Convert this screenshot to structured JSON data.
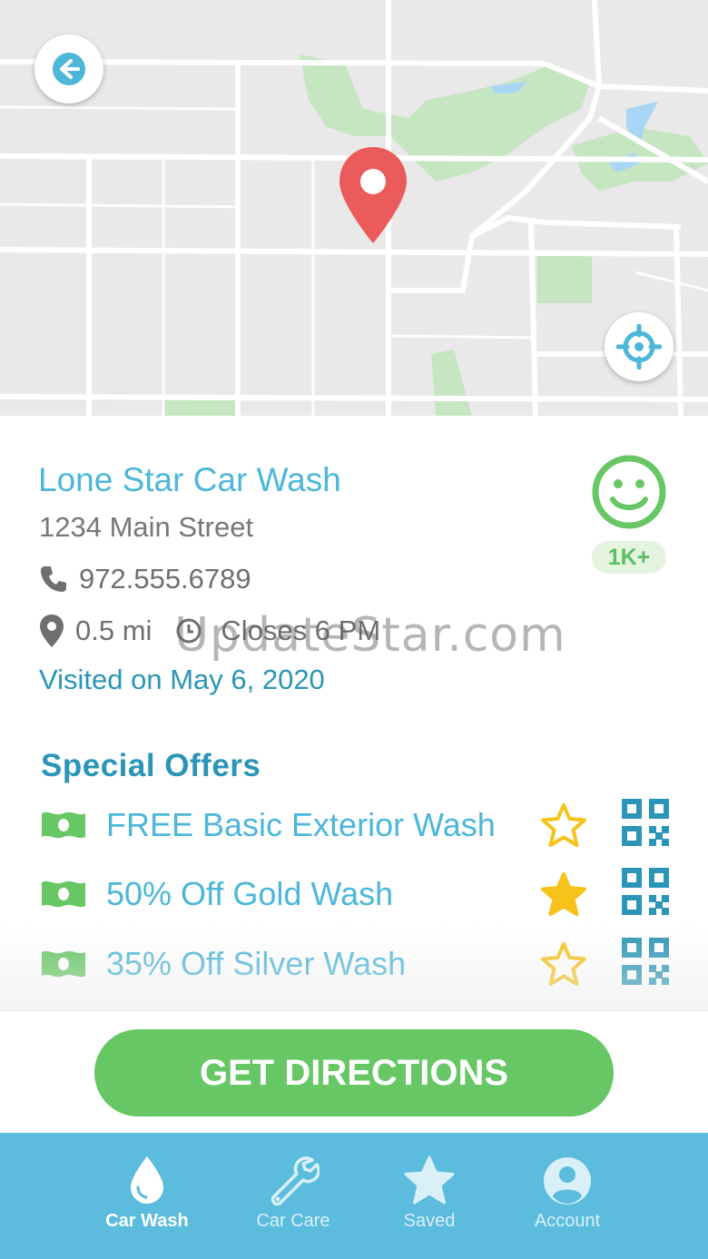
{
  "store": {
    "name": "Lone Star Car Wash",
    "address": "1234 Main Street",
    "phone": "972.555.6789",
    "distance": "0.5 mi",
    "hours": "Closes 6 PM",
    "visited": "Visited on May 6, 2020",
    "rating_badge": "1K+"
  },
  "offers": {
    "title": "Special Offers",
    "items": [
      {
        "label": "FREE Basic Exterior Wash",
        "favorited": false
      },
      {
        "label": "50% Off Gold Wash",
        "favorited": true
      },
      {
        "label": "35% Off Silver Wash",
        "favorited": false
      }
    ]
  },
  "cta": {
    "label": "GET DIRECTIONS"
  },
  "tabs": [
    {
      "label": "Car Wash",
      "icon": "water-drop-icon",
      "active": true
    },
    {
      "label": "Car Care",
      "icon": "wrench-icon",
      "active": false
    },
    {
      "label": "Saved",
      "icon": "star-icon",
      "active": false
    },
    {
      "label": "Account",
      "icon": "user-circle-icon",
      "active": false
    }
  ],
  "watermark": "UpdateStar.com",
  "colors": {
    "primary": "#4cb7d9",
    "dark_blue": "#2a95b6",
    "green": "#66c764",
    "gold": "#f7c21a",
    "pin_red": "#ec5b5b",
    "tab_bar": "#5bbcdd"
  }
}
